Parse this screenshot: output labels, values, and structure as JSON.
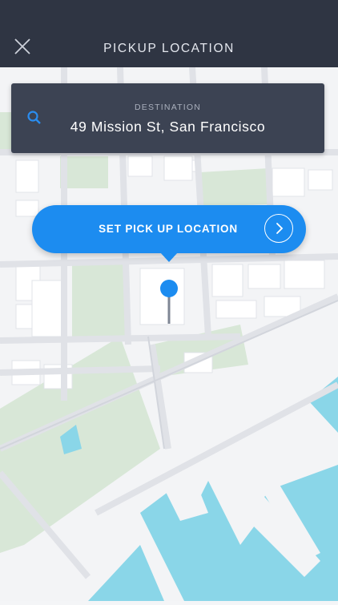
{
  "header": {
    "title": "PICKUP LOCATION"
  },
  "destination": {
    "label": "DESTINATION",
    "value": "49 Mission St, San Francisco"
  },
  "pickup": {
    "label": "SET PICK UP LOCATION"
  },
  "icons": {
    "close": "close-icon",
    "search": "search-icon",
    "arrow": "chevron-right-icon",
    "pin": "map-pin-icon"
  },
  "colors": {
    "header": "#2f3543",
    "card": "#3c4353",
    "accent": "#1c8cf0",
    "water": "#8ad6e8",
    "park": "#d7e6d6",
    "road": "#e3e5ea"
  }
}
